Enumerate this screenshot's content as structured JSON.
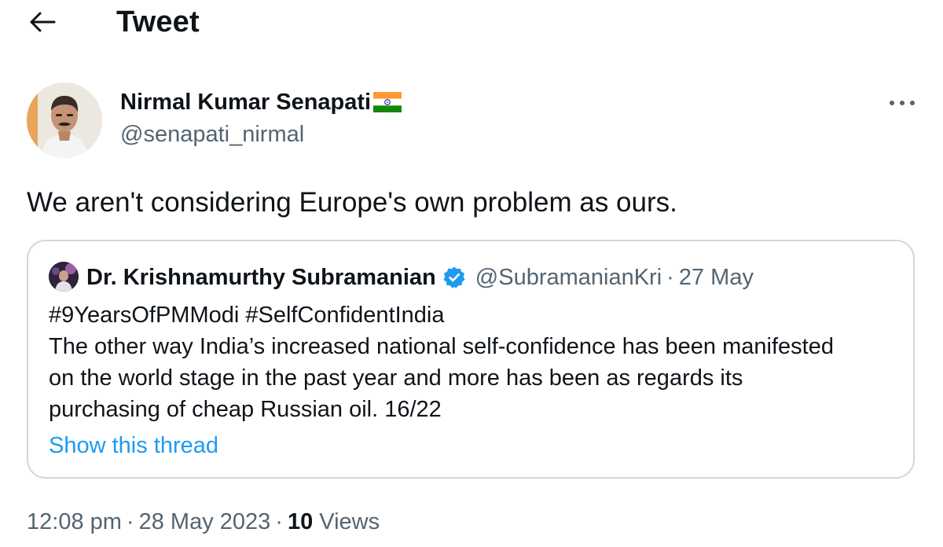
{
  "header": {
    "title": "Tweet",
    "back_icon": "arrow-left-icon"
  },
  "tweet": {
    "author": {
      "name": "Nirmal Kumar Senapati",
      "handle": "@senapati_nirmal",
      "flag_icon": "india-flag-icon"
    },
    "text": "We aren't considering Europe's own problem as ours.",
    "more_icon": "more-options-icon",
    "quote": {
      "author_name": "Dr. Krishnamurthy Subramanian",
      "verified_icon": "verified-badge-icon",
      "handle": "@SubramanianKri",
      "separator": "·",
      "date": "27 May",
      "lines": [
        "#9YearsOfPMModi #SelfConfidentIndia",
        "The other way India’s increased national self-confidence has been manifested",
        "on the world stage in the past year and more has been as regards its",
        "purchasing of cheap Russian oil. 16/22"
      ],
      "show_thread": "Show this thread"
    },
    "meta": {
      "time": "12:08 pm",
      "separator": "·",
      "date": "28 May 2023",
      "views_count": "10",
      "views_label": "Views"
    }
  },
  "colors": {
    "text_primary": "#0f1419",
    "text_secondary": "#536471",
    "link": "#1d9bf0",
    "border": "#cfd9de",
    "verified": "#1d9bf0"
  }
}
